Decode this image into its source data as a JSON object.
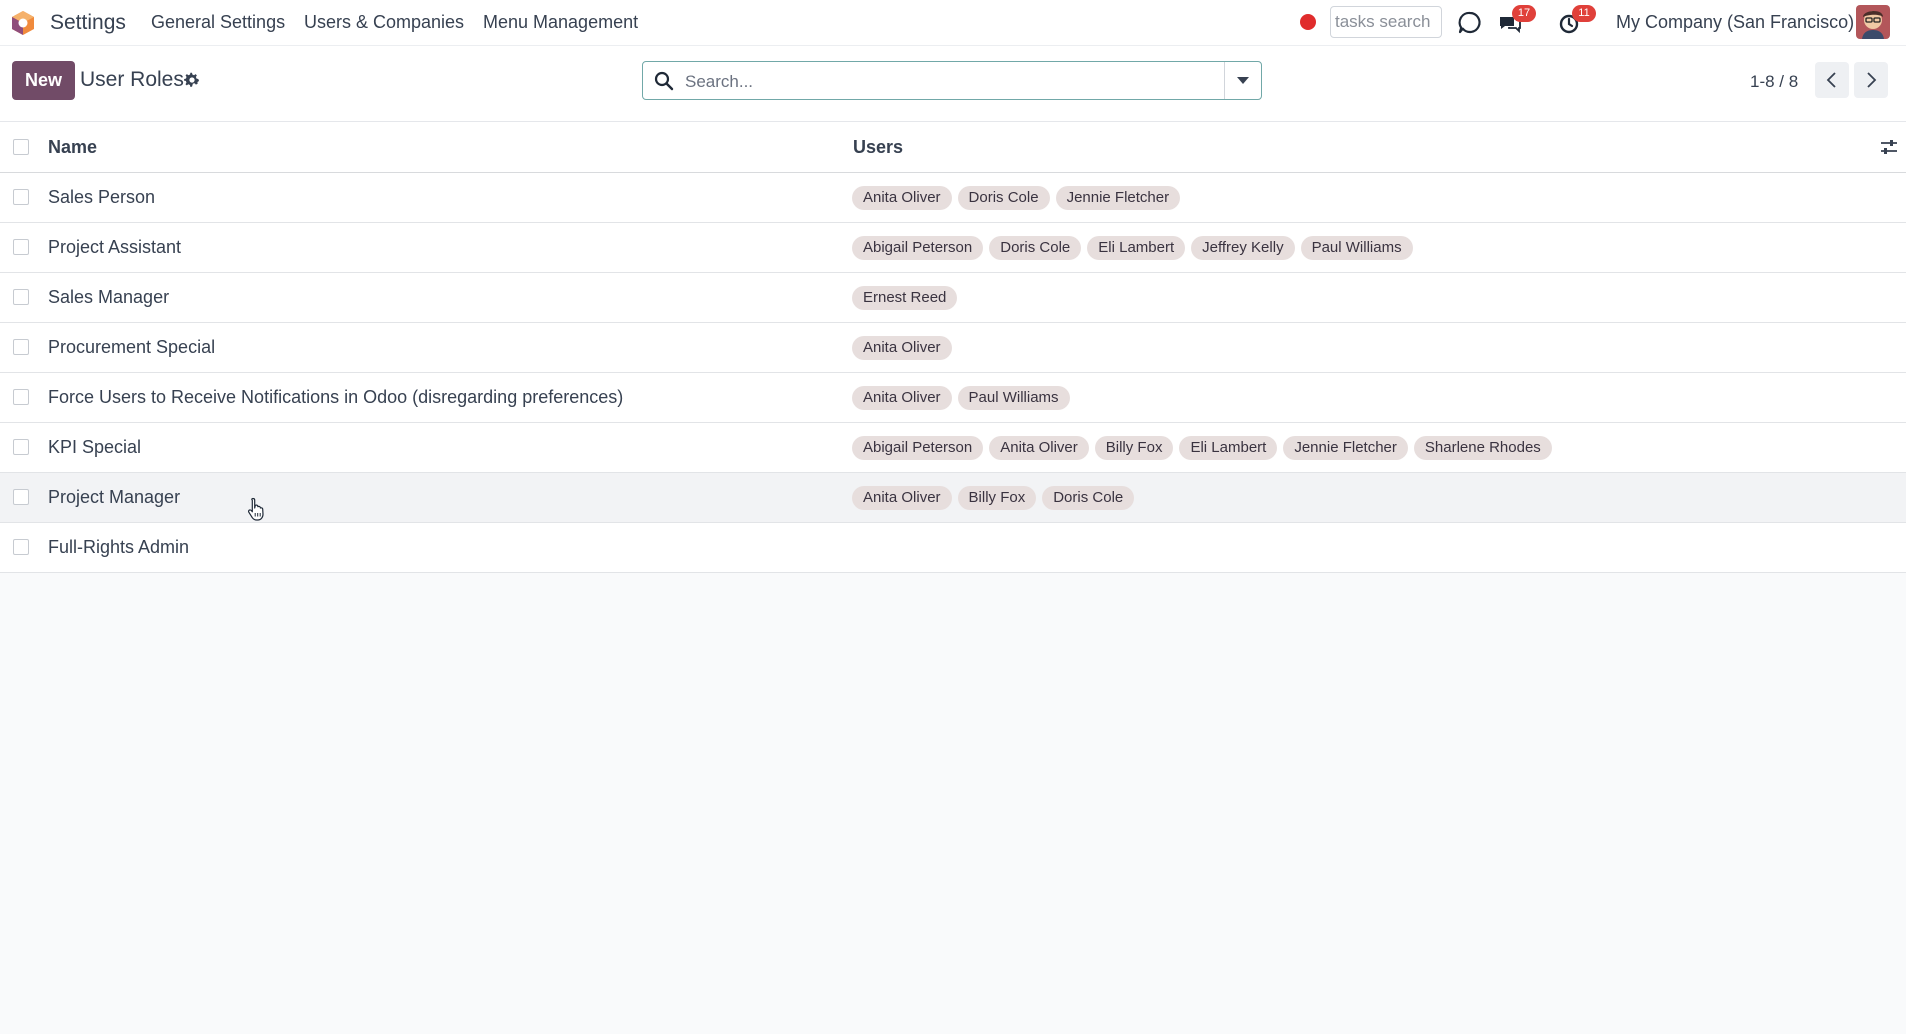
{
  "navbar": {
    "app_name": "Settings",
    "menus": [
      "General Settings",
      "Users & Companies",
      "Menu Management"
    ],
    "tasks_search_placeholder": "tasks search",
    "messages_badge": "17",
    "activities_badge": "11",
    "company": "My Company (San Francisco)"
  },
  "control_panel": {
    "new_label": "New",
    "title": "User Roles",
    "search_placeholder": "Search...",
    "pager": "1-8 / 8"
  },
  "list": {
    "columns": {
      "name": "Name",
      "users": "Users"
    },
    "rows": [
      {
        "name": "Sales Person",
        "users": [
          "Anita Oliver",
          "Doris Cole",
          "Jennie Fletcher"
        ]
      },
      {
        "name": "Project Assistant",
        "users": [
          "Abigail Peterson",
          "Doris Cole",
          "Eli Lambert",
          "Jeffrey Kelly",
          "Paul Williams"
        ]
      },
      {
        "name": "Sales Manager",
        "users": [
          "Ernest Reed"
        ]
      },
      {
        "name": "Procurement Special",
        "users": [
          "Anita Oliver"
        ]
      },
      {
        "name": "Force Users to Receive Notifications in Odoo (disregarding preferences)",
        "users": [
          "Anita Oliver",
          "Paul Williams"
        ]
      },
      {
        "name": "KPI Special",
        "users": [
          "Abigail Peterson",
          "Anita Oliver",
          "Billy Fox",
          "Eli Lambert",
          "Jennie Fletcher",
          "Sharlene Rhodes"
        ]
      },
      {
        "name": "Project Manager",
        "users": [
          "Anita Oliver",
          "Billy Fox",
          "Doris Cole"
        ]
      },
      {
        "name": "Full-Rights Admin",
        "users": []
      }
    ]
  },
  "colors": {
    "brand": "#714b67",
    "badge": "#e0403a",
    "tag_bg": "#e7dedd",
    "record_dot": "#e02c2c"
  }
}
